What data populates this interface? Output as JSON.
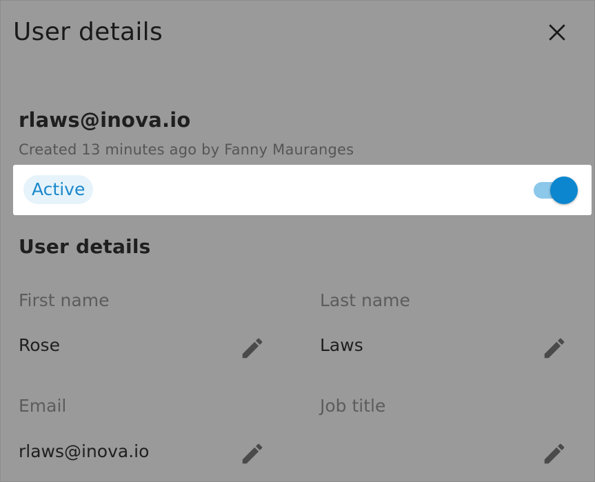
{
  "header": {
    "title": "User details",
    "close_icon": "close-icon"
  },
  "user": {
    "email": "rlaws@inova.io",
    "created_text": "Created 13 minutes ago by Fanny Mauranges"
  },
  "status": {
    "badge": "Active",
    "toggle_on": true,
    "accent_color": "#0b86cf"
  },
  "details": {
    "section_title": "User details",
    "fields": [
      {
        "label": "First name",
        "value": "Rose",
        "icon": "pencil-icon"
      },
      {
        "label": "Last name",
        "value": "Laws",
        "icon": "pencil-icon"
      },
      {
        "label": "Email",
        "value": "rlaws@inova.io",
        "icon": "pencil-icon"
      },
      {
        "label": "Job title",
        "value": "",
        "icon": "pencil-icon"
      }
    ]
  }
}
